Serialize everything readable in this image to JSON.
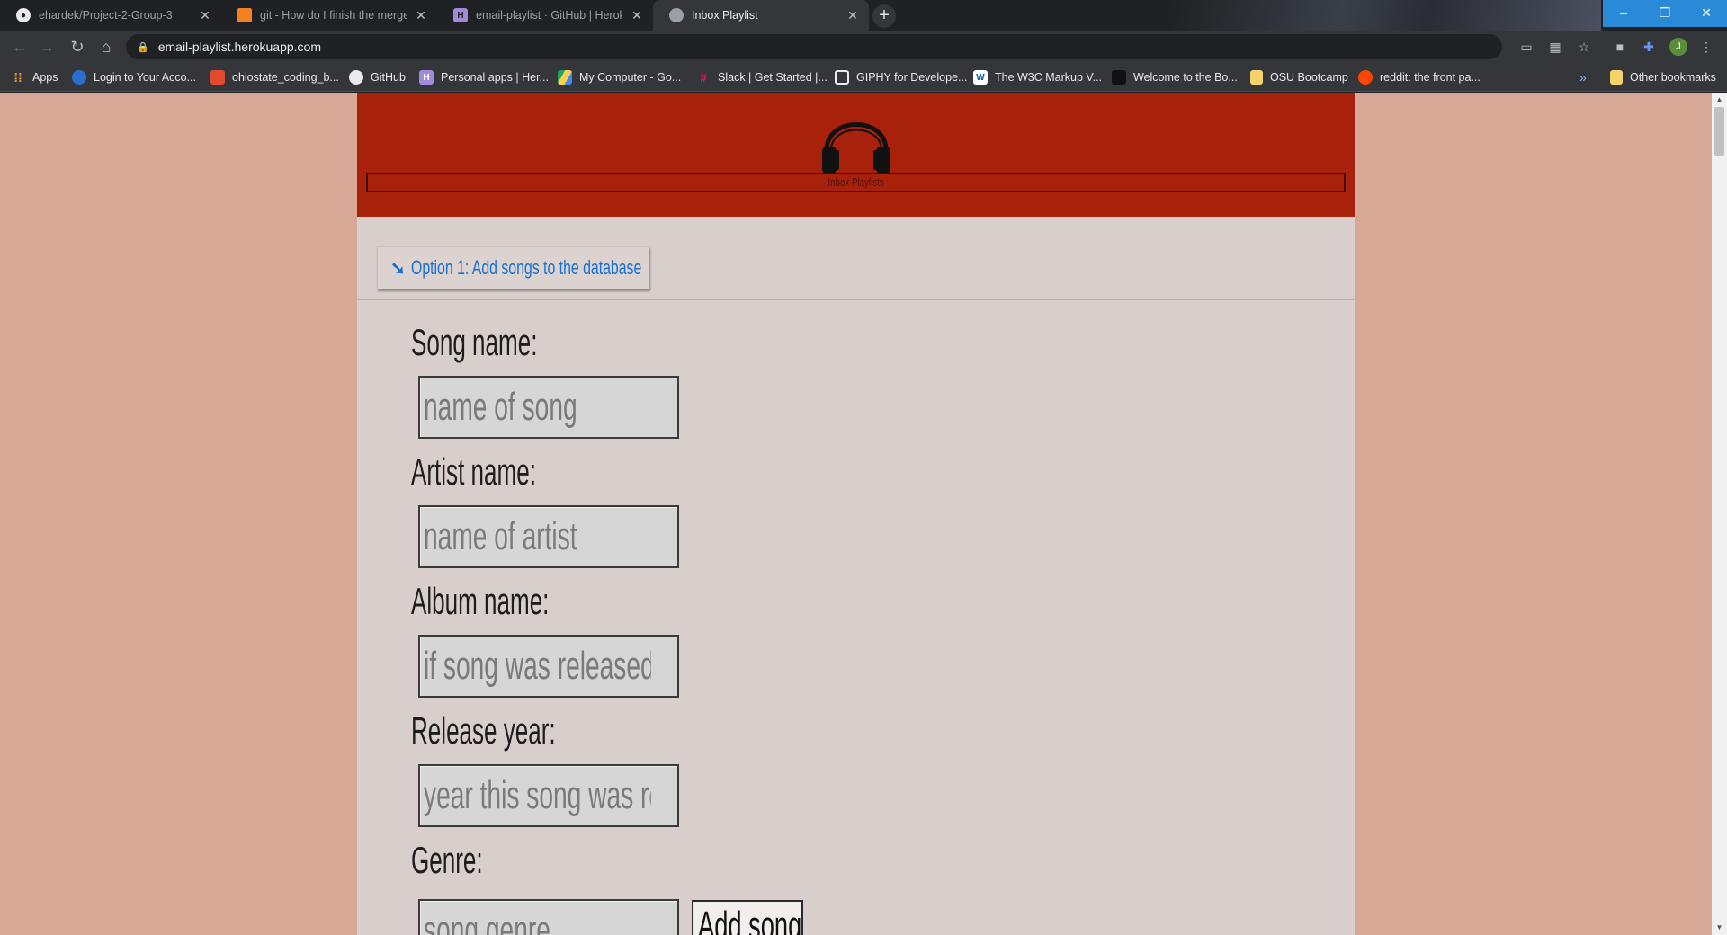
{
  "tabs": [
    {
      "title": "ehardek/Project-2-Group-3",
      "favicon": "github-icon",
      "active": false
    },
    {
      "title": "git - How do I finish the merge af",
      "favicon": "stackoverflow-icon",
      "active": false
    },
    {
      "title": "email-playlist · GitHub | Heroku",
      "favicon": "heroku-icon",
      "active": false
    },
    {
      "title": "Inbox Playlist",
      "favicon": "globe-icon",
      "active": true
    }
  ],
  "address_bar": {
    "url": "email-playlist.herokuapp.com"
  },
  "profile_initial": "J",
  "bookmarks": [
    {
      "label": "Apps",
      "icon": "apps-grid-icon"
    },
    {
      "label": "Login to Your Acco...",
      "icon": "globe-icon"
    },
    {
      "label": "ohiostate_coding_b...",
      "icon": "gitlab-icon"
    },
    {
      "label": "GitHub",
      "icon": "github-icon"
    },
    {
      "label": "Personal apps | Her...",
      "icon": "heroku-icon"
    },
    {
      "label": "My Computer - Go...",
      "icon": "drive-icon"
    },
    {
      "label": "Slack | Get Started |...",
      "icon": "slack-icon"
    },
    {
      "label": "GIPHY for Develope...",
      "icon": "giphy-icon"
    },
    {
      "label": "The W3C Markup V...",
      "icon": "w3c-icon"
    },
    {
      "label": "Welcome to the Bo...",
      "icon": "book-icon"
    },
    {
      "label": "OSU Bootcamp",
      "icon": "folder-icon"
    },
    {
      "label": "reddit: the front pa...",
      "icon": "reddit-icon"
    }
  ],
  "other_bookmarks": "Other bookmarks",
  "page": {
    "header_title": "Inbox Playlists",
    "option_button": "Option 1: Add songs to the database",
    "fields": [
      {
        "label": "Song name:",
        "placeholder": "name of song"
      },
      {
        "label": "Artist name:",
        "placeholder": "name of artist"
      },
      {
        "label": "Album name:",
        "placeholder": "if song was released on album"
      },
      {
        "label": "Release year:",
        "placeholder": "year this song was released"
      },
      {
        "label": "Genre:",
        "placeholder": "song genre"
      }
    ],
    "add_button": "Add song"
  },
  "colors": {
    "page_background": "#d8a897",
    "header_red": "#a8210b",
    "container_background": "#d8cecc",
    "link_blue": "#1a6fd0"
  }
}
